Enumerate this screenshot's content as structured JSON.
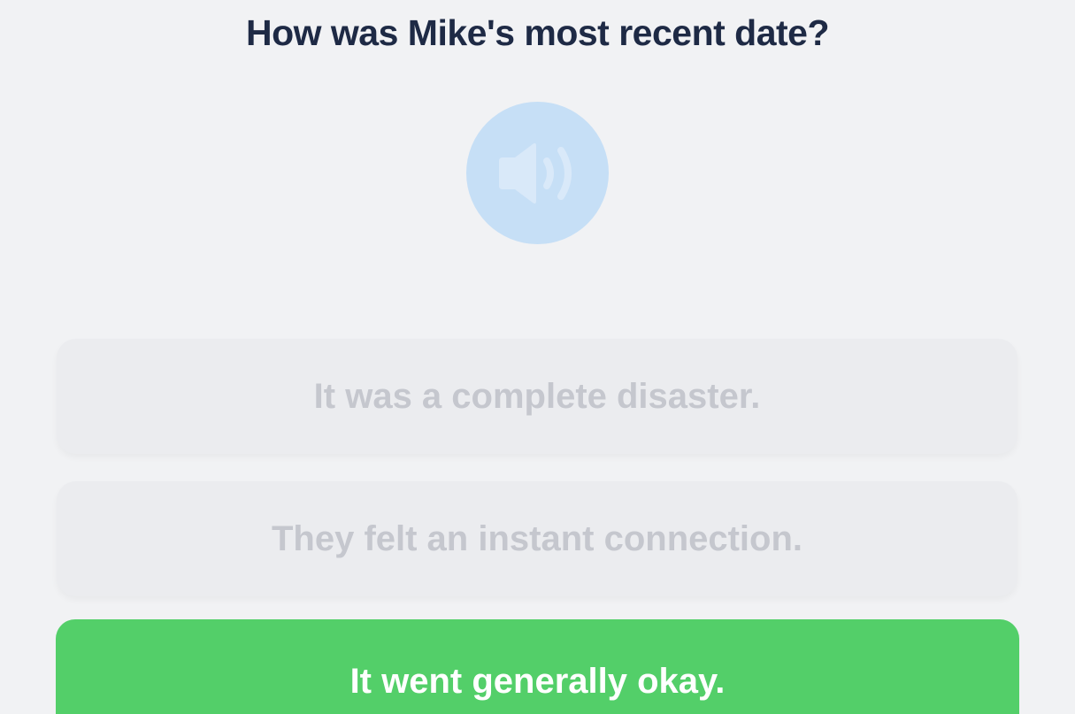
{
  "question": {
    "text": "How was Mike's most recent date?"
  },
  "audio": {
    "icon": "speaker-icon",
    "color": "#c6dff6"
  },
  "options": [
    {
      "label": "It was a complete disaster.",
      "state": "disabled"
    },
    {
      "label": "They felt an instant connection.",
      "state": "disabled"
    },
    {
      "label": "It went generally okay.",
      "state": "selected"
    }
  ],
  "colors": {
    "selected": "#53cf69",
    "disabled_bg": "#ebecef",
    "disabled_text": "#c5c7ce",
    "question_text": "#1e2a45"
  }
}
